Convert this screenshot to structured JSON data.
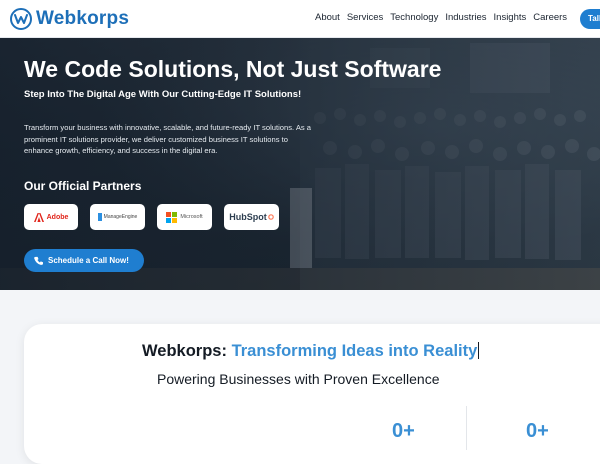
{
  "nav": {
    "brand": "Webkorps",
    "logo_icon": "wave-w-logo-icon",
    "items": [
      {
        "label": "About"
      },
      {
        "label": "Services"
      },
      {
        "label": "Technology"
      },
      {
        "label": "Industries"
      },
      {
        "label": "Insights"
      },
      {
        "label": "Careers"
      }
    ],
    "cta_label": "Talk"
  },
  "hero": {
    "title": "We Code Solutions, Not Just Software",
    "subtitle": "Step Into The Digital Age With Our Cutting-Edge IT Solutions!",
    "description": "Transform your business with innovative, scalable, and future-ready IT solutions. As a prominent IT solutions provider, we deliver customized business IT solutions to enhance growth, efficiency, and success in the digital era.",
    "partners_title": "Our Official Partners",
    "partners": [
      {
        "name": "Adobe",
        "icon": "adobe-logo-icon"
      },
      {
        "name": "ManageEngine",
        "icon": "manageengine-logo-icon"
      },
      {
        "name": "Microsoft",
        "icon": "microsoft-logo-icon"
      },
      {
        "name": "HubSpot",
        "icon": "hubspot-logo-icon"
      }
    ],
    "schedule_label": "Schedule a Call Now!",
    "schedule_icon": "phone-icon"
  },
  "section": {
    "headline_prefix": "Webkorps:",
    "headline_accent": "Transforming Ideas into Reality",
    "subheadline": "Powering Businesses with Proven Excellence",
    "stats": [
      {
        "value": "0+"
      },
      {
        "value": "0+"
      }
    ]
  },
  "colors": {
    "brand": "#1d6fb8",
    "accent": "#3a8fd4",
    "button": "#1f7ed0",
    "hero_overlay": "#1d2832"
  }
}
